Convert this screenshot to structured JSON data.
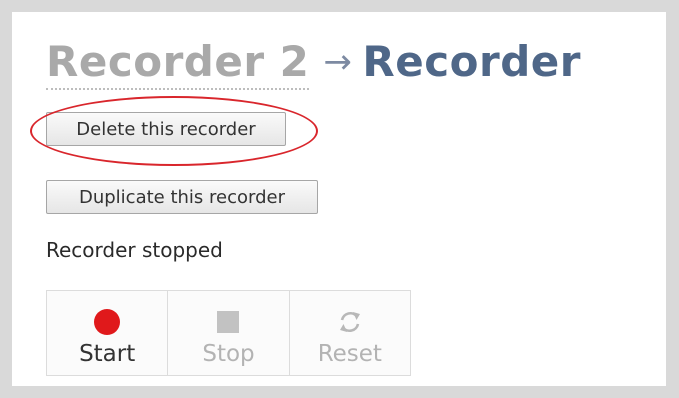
{
  "header": {
    "breadcrumb_parent": "Recorder 2",
    "separator": "→",
    "current": "Recorder"
  },
  "actions": {
    "delete_label": "Delete this recorder",
    "duplicate_label": "Duplicate this recorder"
  },
  "status": {
    "text": "Recorder stopped"
  },
  "controls": {
    "start_label": "Start",
    "stop_label": "Stop",
    "reset_label": "Reset",
    "start_icon": "record-icon",
    "stop_icon": "stop-icon",
    "reset_icon": "reset-icon"
  },
  "colors": {
    "record": "#e0191b",
    "highlight": "#d9262c",
    "title_current": "#4f6788",
    "title_parent": "#a9a9a9"
  }
}
